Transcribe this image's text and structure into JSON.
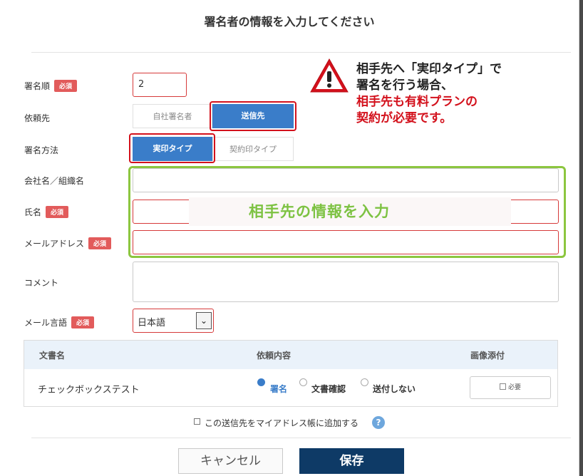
{
  "title": "署名者の情報を入力してください",
  "form": {
    "required_badge": "必須",
    "order_label": "署名順",
    "order_value": "2",
    "recipient_label": "依頼先",
    "recipient_options": [
      "自社署名者",
      "送信先"
    ],
    "method_label": "署名方法",
    "method_options": [
      "実印タイプ",
      "契約印タイプ"
    ],
    "company_label": "会社名／組織名",
    "name_label": "氏名",
    "email_label": "メールアドレス",
    "comment_label": "コメント",
    "language_label": "メール言語",
    "language_value": "日本語"
  },
  "annotation": {
    "green_text": "相手先の情報を入力",
    "callout_line1": "相手先へ「実印タイプ」で",
    "callout_line2": "署名を行う場合、",
    "callout_line3": "相手先も有料プランの",
    "callout_line4": "契約が必要です。"
  },
  "table": {
    "headers": [
      "文書名",
      "依頼内容",
      "画像添付"
    ],
    "row": {
      "document": "チェックボックステスト",
      "options": [
        "署名",
        "文書確認",
        "送付しない"
      ],
      "selected": "署名",
      "attach_label": "必要"
    }
  },
  "address_book_label": "この送信先をマイアドレス帳に追加する",
  "help_icon": "?",
  "buttons": {
    "cancel": "キャンセル",
    "save": "保存"
  },
  "colors": {
    "accent": "#3a7dc9",
    "required": "#e25b5b",
    "highlight_red": "#d3111c",
    "highlight_green": "#8cc63f",
    "save_button": "#0e3a66"
  }
}
